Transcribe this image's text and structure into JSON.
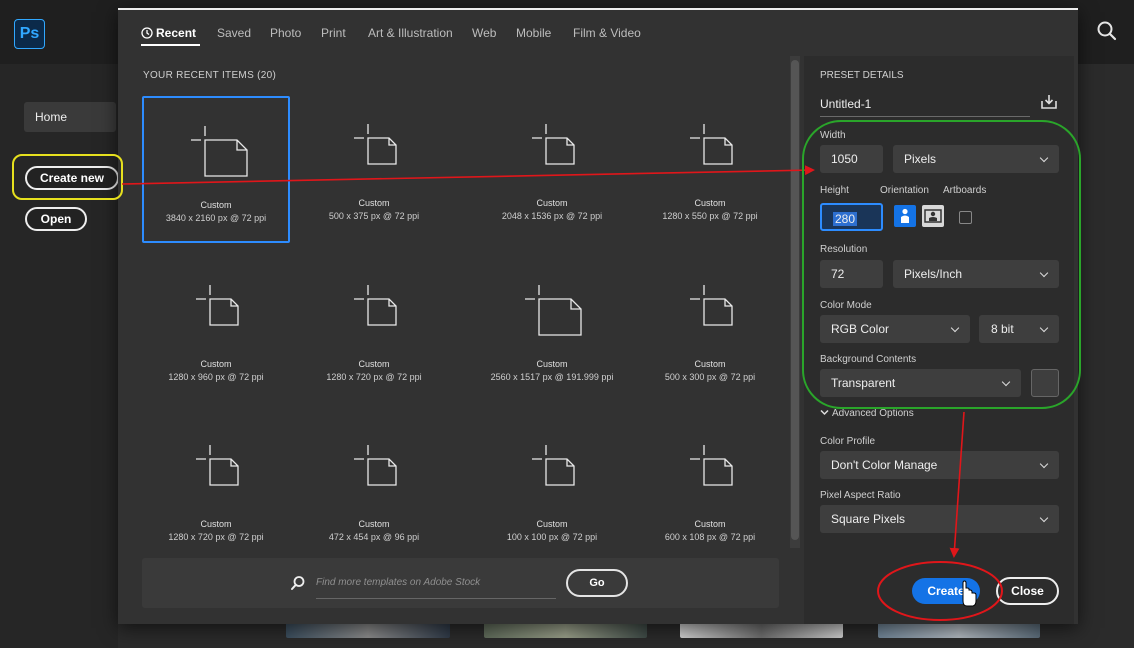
{
  "app": {
    "logo": "Ps",
    "home_label": "Home",
    "create_new_label": "Create new",
    "open_label": "Open",
    "search_icon": "search-icon"
  },
  "tabs": [
    {
      "label": "Recent",
      "active": true,
      "icon": "clock-icon"
    },
    {
      "label": "Saved"
    },
    {
      "label": "Photo"
    },
    {
      "label": "Print"
    },
    {
      "label": "Art & Illustration"
    },
    {
      "label": "Web"
    },
    {
      "label": "Mobile"
    },
    {
      "label": "Film & Video"
    }
  ],
  "recent": {
    "title": "YOUR RECENT ITEMS  (20)",
    "items": [
      {
        "name": "Custom",
        "size": "3840 x 2160 px @ 72 ppi",
        "selected": true
      },
      {
        "name": "Custom",
        "size": "500 x 375 px @ 72 ppi"
      },
      {
        "name": "Custom",
        "size": "2048 x 1536 px @ 72 ppi"
      },
      {
        "name": "Custom",
        "size": "1280 x 550 px @ 72 ppi"
      },
      {
        "name": "Custom",
        "size": "1280 x 960 px @ 72 ppi"
      },
      {
        "name": "Custom",
        "size": "1280 x 720 px @ 72 ppi"
      },
      {
        "name": "Custom",
        "size": "2560 x 1517 px @ 191.999 ppi"
      },
      {
        "name": "Custom",
        "size": "500 x 300 px @ 72 ppi"
      },
      {
        "name": "Custom",
        "size": "1280 x 720 px @ 72 ppi"
      },
      {
        "name": "Custom",
        "size": "472 x 454 px @ 96 ppi"
      },
      {
        "name": "Custom",
        "size": "100 x 100 px @ 72 ppi"
      },
      {
        "name": "Custom",
        "size": "600 x 108 px @ 72 ppi"
      }
    ]
  },
  "stock": {
    "placeholder": "Find more templates on Adobe Stock",
    "go_label": "Go"
  },
  "preset": {
    "title": "PRESET DETAILS",
    "name": "Untitled-1",
    "width_label": "Width",
    "width_value": "1050",
    "width_unit": "Pixels",
    "height_label": "Height",
    "height_value": "280",
    "orientation_label": "Orientation",
    "artboards_label": "Artboards",
    "resolution_label": "Resolution",
    "resolution_value": "72",
    "resolution_unit": "Pixels/Inch",
    "color_mode_label": "Color Mode",
    "color_mode": "RGB Color",
    "bit_depth": "8 bit",
    "bg_label": "Background Contents",
    "bg_value": "Transparent",
    "advanced_label": "Advanced Options",
    "profile_label": "Color Profile",
    "profile_value": "Don't Color Manage",
    "par_label": "Pixel Aspect Ratio",
    "par_value": "Square Pixels",
    "create_label": "Create",
    "close_label": "Close"
  },
  "colors": {
    "accent": "#1473e6",
    "annotation_red": "#e0161a",
    "annotation_yellow": "#e6e01e",
    "annotation_green": "#2aa52a"
  }
}
